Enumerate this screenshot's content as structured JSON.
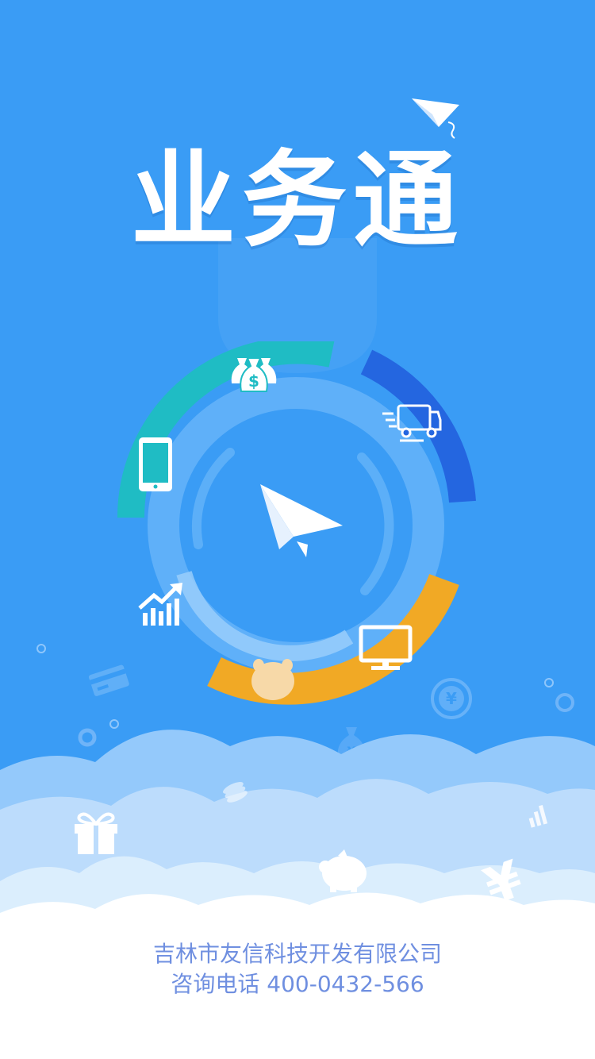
{
  "app": {
    "title": "业务通"
  },
  "footer": {
    "company_name": "吉林市友信科技开发有限公司",
    "hotline_label": "咨询电话",
    "hotline_number": "400-0432-566"
  },
  "icons": {
    "hub": [
      "money-bags-icon",
      "delivery-truck-icon",
      "monitor-icon",
      "piggy-face-icon",
      "growth-chart-icon",
      "smartphone-icon",
      "paper-plane-icon"
    ],
    "decor": [
      "paper-plane-icon",
      "credit-card-icon",
      "yen-coin-icon",
      "money-bag-icon",
      "gift-icon",
      "piggy-bank-icon",
      "yen-sign-icon",
      "bar-chart-icon"
    ]
  },
  "colors": {
    "background": "#3a9cf5",
    "teal_segment": "#1fbcc4",
    "blue_segment": "#2466e0",
    "orange_segment": "#f1a925",
    "footer_text": "#6f8fe0"
  }
}
